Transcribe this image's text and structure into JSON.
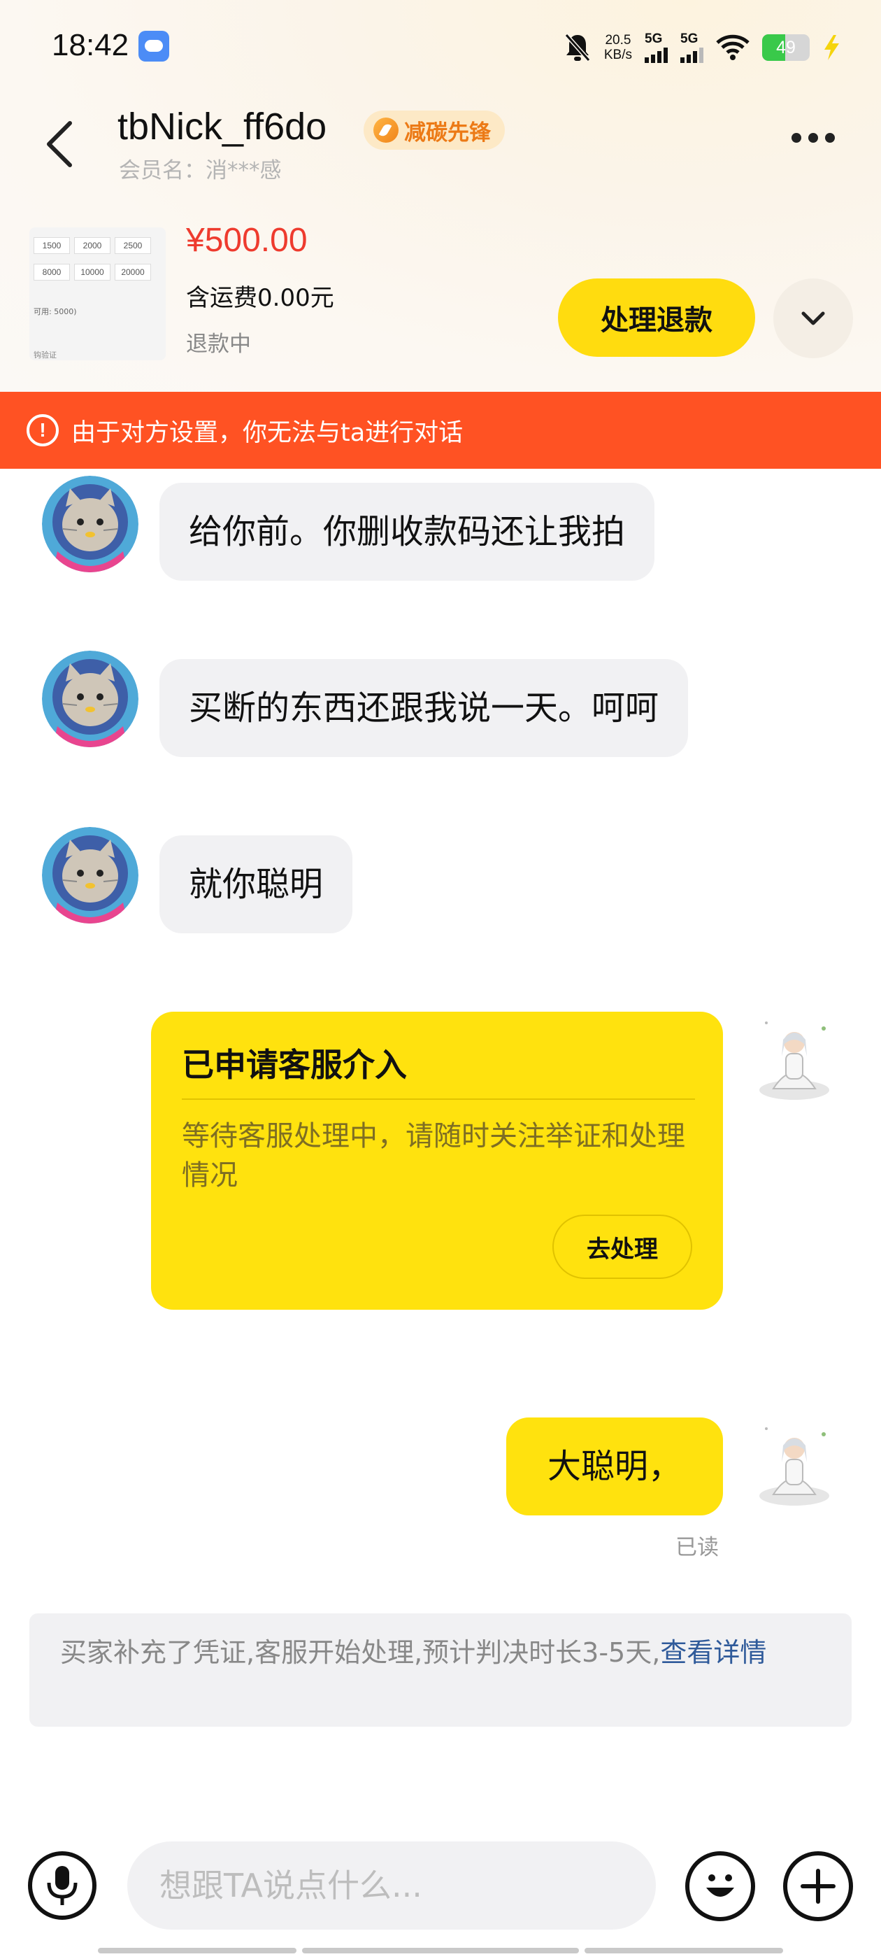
{
  "status_bar": {
    "time": "18:42",
    "net_speed_value": "20.5",
    "net_speed_unit": "KB/s",
    "sim1": "5G",
    "sim2": "5G",
    "battery": "49",
    "battery_level": 0.49
  },
  "header": {
    "name": "tbNick_ff6do",
    "badge": "减碳先锋",
    "member_name": "会员名：消***感"
  },
  "order": {
    "thumb_cells_row1": [
      "1500",
      "2000",
      "2500"
    ],
    "thumb_cells_row2": [
      "8000",
      "10000",
      "20000"
    ],
    "thumb_line": "可用: 5000)",
    "thumb_line2": "钩验证",
    "price": "¥500.00",
    "shipping": "含运费0.00元",
    "status": "退款中",
    "refund_button": "处理退款"
  },
  "warning": {
    "text": "由于对方设置，你无法与ta进行对话"
  },
  "messages": [
    {
      "text": "给你前。你删收款码还让我拍"
    },
    {
      "text": "买断的东西还跟我说一天。呵呵"
    },
    {
      "text": "就你聪明"
    }
  ],
  "service_card": {
    "title": "已申请客服介入",
    "desc": "等待客服处理中，请随时关注举证和处理情况",
    "button": "去处理"
  },
  "my_message": {
    "text": "大聪明，",
    "read_status": "已读"
  },
  "system_notice": {
    "text": "买家补充了凭证,客服开始处理,预计判决时长3-5天,",
    "link": "查看详情"
  },
  "input_bar": {
    "placeholder": "想跟TA说点什么..."
  },
  "colors": {
    "accent_yellow": "#ffe20e",
    "warning_orange": "#ff5223",
    "price_red": "#ee3b2e",
    "link_blue": "#2f5a9a"
  }
}
